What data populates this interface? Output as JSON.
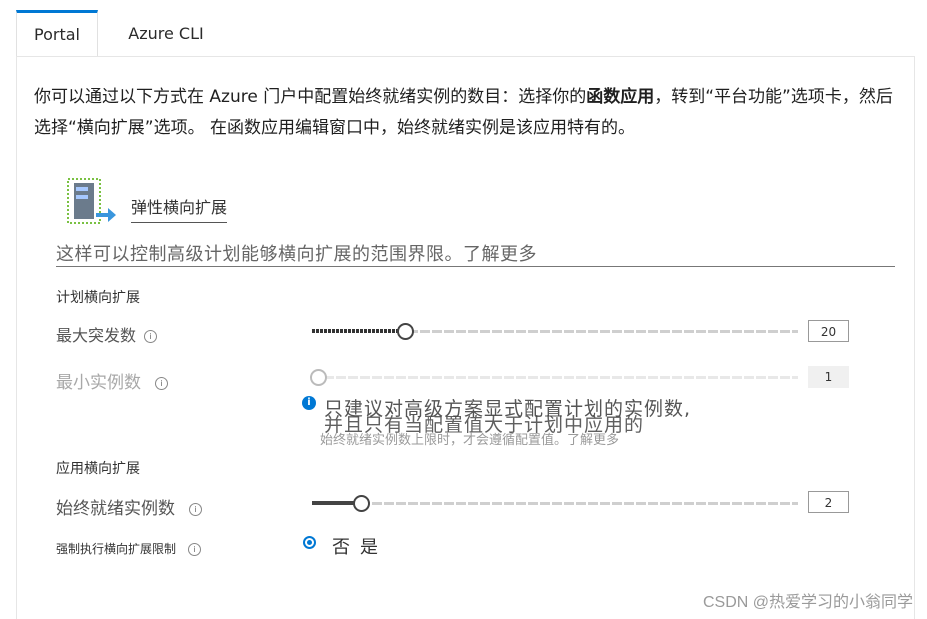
{
  "tabs": [
    {
      "label": "Portal",
      "active": true
    },
    {
      "label": "Azure CLI",
      "active": false
    }
  ],
  "intro": {
    "part1": "你可以通过以下方式在 Azure 门户中配置始终就绪实例的数目：选择你的",
    "bold": "函数应用",
    "part2": "，转到“平台功能”选项卡，然后选择“横向扩展”选项。 在函数应用编辑窗口中，始终就绪实例是该应用特有的。"
  },
  "scale": {
    "icon": "scale-out-icon",
    "title": "弹性横向扩展",
    "description": "这样可以控制高级计划能够横向扩展的范围界限。了解更多"
  },
  "plan_section": {
    "heading": "计划横向扩展",
    "max_burst": {
      "label": "最大突发数",
      "value": "20",
      "fraction": 0.19
    },
    "min_instances": {
      "label": "最小实例数",
      "value": "1",
      "fraction": 0.0,
      "disabled": true
    }
  },
  "note": {
    "icon": "info-icon",
    "line1": "只建议对高级方案显式配置计划的实例数,",
    "line2": "并且只有当配置值大于计划中应用的",
    "line3": "始终就绪实例数上限时，才会遵循配置值。了解更多"
  },
  "app_section": {
    "heading": "应用横向扩展",
    "always_ready": {
      "label": "始终就绪实例数",
      "value": "2",
      "fraction": 0.1
    },
    "enforce_limit": {
      "label": "强制执行横向扩展限制",
      "options": [
        "否",
        "是"
      ],
      "selected": "否"
    }
  },
  "watermark": "CSDN @热爱学习的小翁同学",
  "colors": {
    "accent": "#0078d4"
  }
}
